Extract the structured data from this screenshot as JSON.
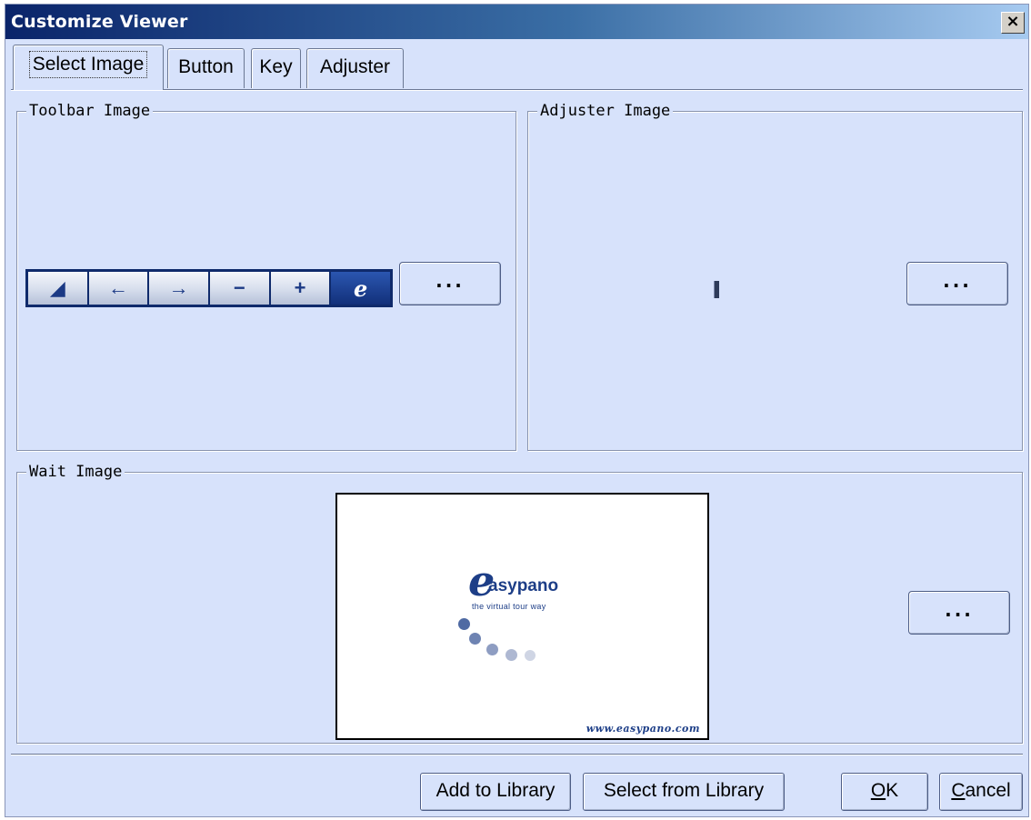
{
  "window": {
    "title": "Customize Viewer",
    "close_glyph": "×"
  },
  "tabs": [
    {
      "label": "Select Image",
      "active": true
    },
    {
      "label": "Button",
      "active": false
    },
    {
      "label": "Key",
      "active": false
    },
    {
      "label": "Adjuster",
      "active": false
    }
  ],
  "groups": {
    "toolbar": {
      "legend": "Toolbar Image",
      "browse_label": "..."
    },
    "adjuster": {
      "legend": "Adjuster Image",
      "browse_label": "..."
    },
    "wait": {
      "legend": "Wait Image",
      "browse_label": "..."
    }
  },
  "toolbar_image": {
    "buttons": [
      "up-ramp-icon",
      "left-arrow-icon",
      "right-arrow-icon",
      "minus-icon",
      "plus-icon",
      "easypano-logo-icon"
    ],
    "glyphs": [
      "◢",
      "←",
      "→",
      "−",
      "+",
      "e"
    ]
  },
  "wait_image": {
    "brand": "asypano",
    "brand_e": "e",
    "slogan": "the virtual tour way",
    "url": "www.easypano.com",
    "dot_colors": [
      "#4f6aa3",
      "#6e83b2",
      "#8e9dc2",
      "#aeb8d2",
      "#cfd5e4"
    ]
  },
  "footer": {
    "add_to_library": "Add to Library",
    "select_from_library": "Select from Library",
    "ok_mnemonic": "O",
    "ok_rest": "K",
    "cancel_mnemonic": "C",
    "cancel_rest": "ancel"
  },
  "colors": {
    "dialog_bg": "#d7e2fb",
    "title_start": "#0a246a",
    "title_end": "#a6caf0",
    "brand_blue": "#1d3e87"
  }
}
